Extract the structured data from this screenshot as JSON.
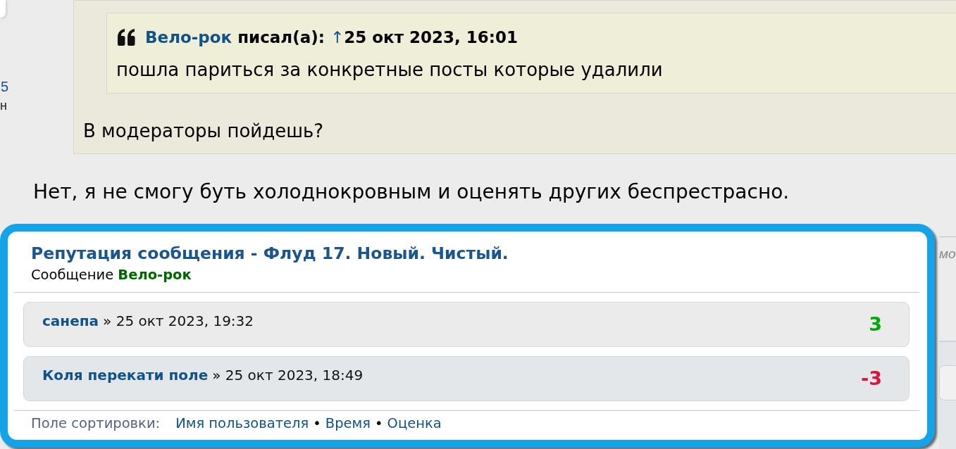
{
  "profile_fragment": {
    "count": "5",
    "text": "н"
  },
  "post": {
    "quote": {
      "nested_quote": {
        "author": "Вело-рок",
        "wrote_label": "писал(а):",
        "jump_link": "↑",
        "date": "25 окт 2023, 16:01",
        "text": "пошла париться за конкретные посты которые удалили"
      },
      "text": "В модераторы пойдешь?"
    },
    "text": "Нет, я не смогу буть холоднокровным и оценять других беспрестрасно."
  },
  "reply_form": {
    "placeholder": "мо"
  },
  "reputation_popup": {
    "title": "Репутация сообщения - Флуд 17. Новый. Чистый.",
    "subtitle_label": "Сообщение",
    "post_author": "Вело-рок",
    "entries": [
      {
        "user": "санепа",
        "date": "» 25 окт 2023, 19:32",
        "points": "3",
        "color": "#00aa00"
      },
      {
        "user": "Коля перекати поле",
        "date": "» 25 окт 2023, 18:49",
        "points": "-3",
        "color": "#dc143c"
      }
    ],
    "sort_label": "Поле сортировки:",
    "sort_items": [
      {
        "kind": "link",
        "text": "Имя пользователя"
      },
      {
        "kind": "separator",
        "text": "•"
      },
      {
        "kind": "link",
        "text": "Время"
      },
      {
        "kind": "separator",
        "text": "•"
      },
      {
        "kind": "link",
        "text": "Оценка"
      }
    ]
  }
}
